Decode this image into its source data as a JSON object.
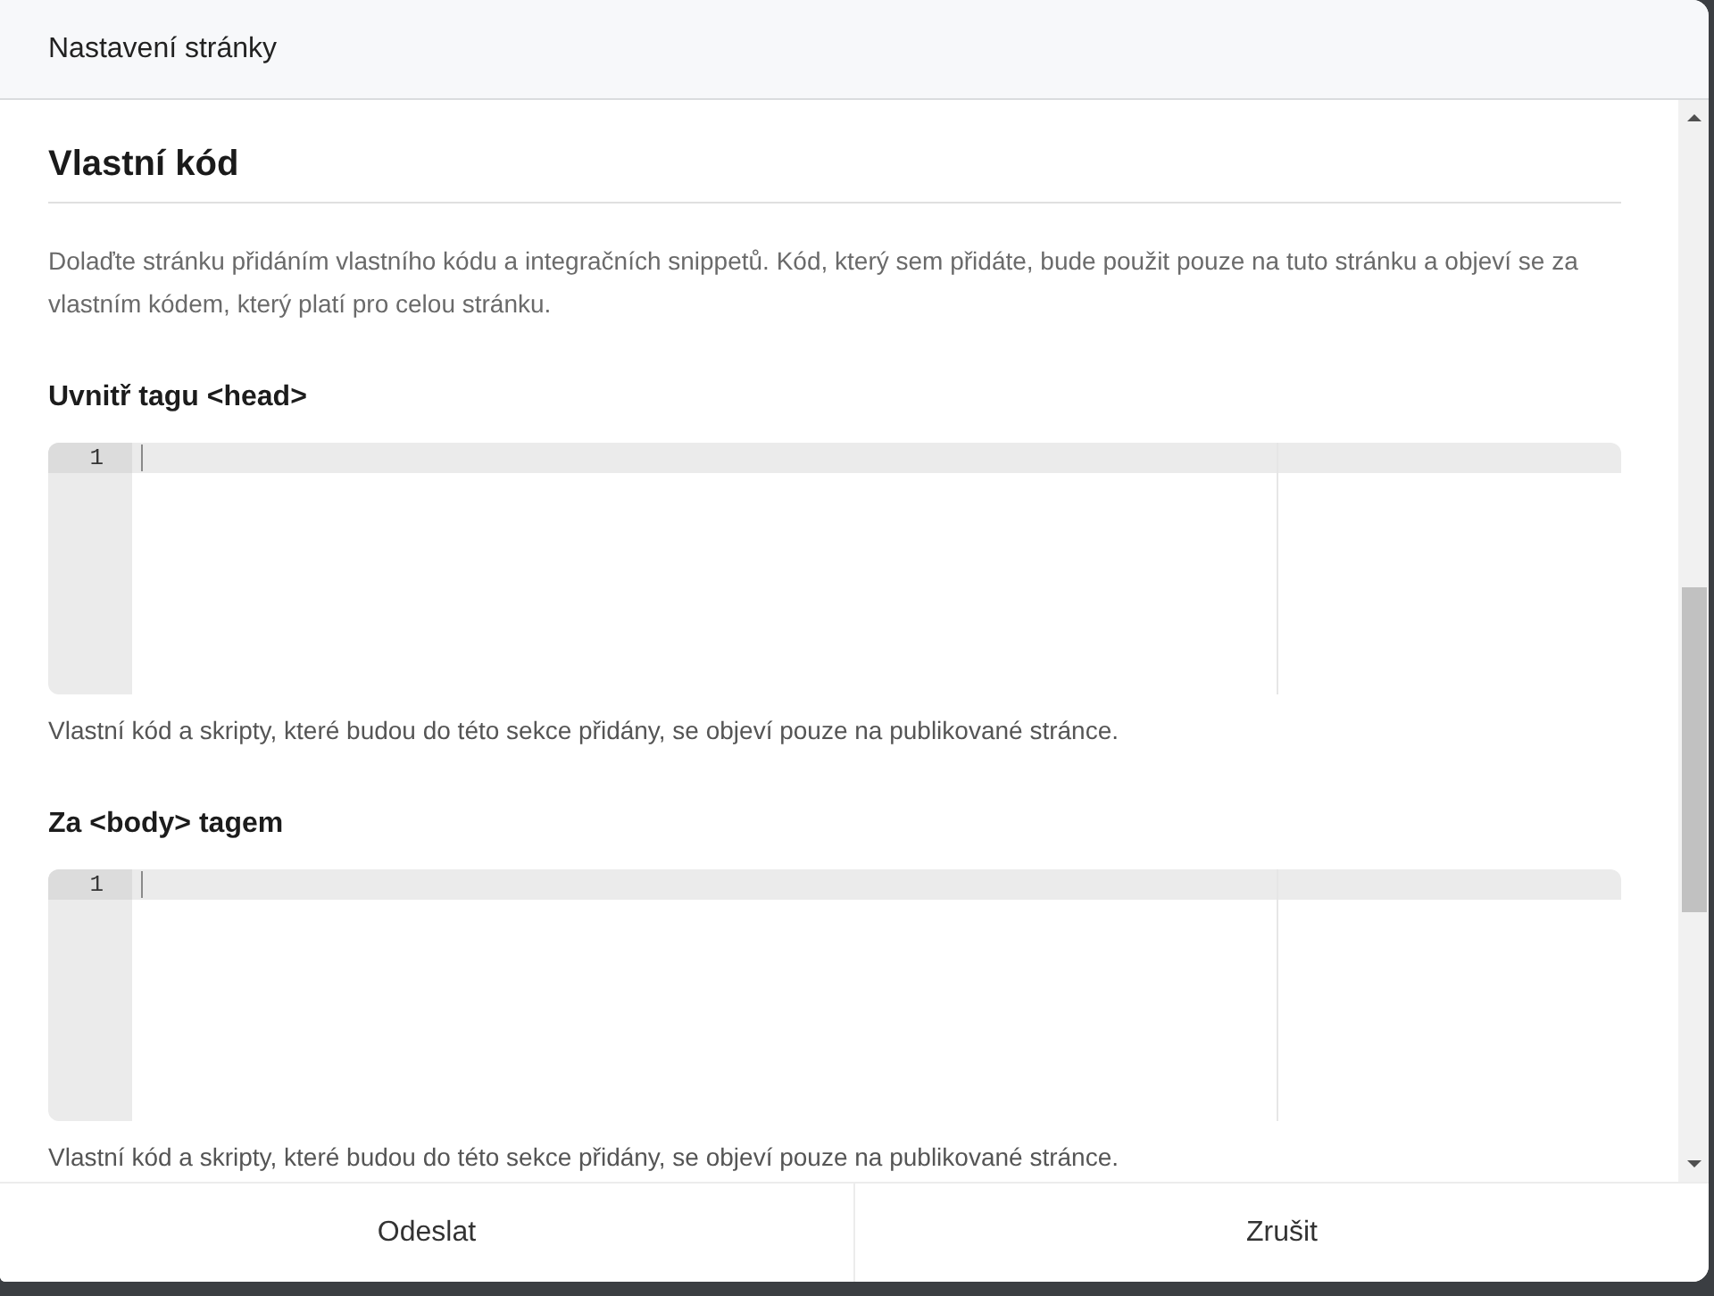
{
  "dialog": {
    "title": "Nastavení stránky"
  },
  "section": {
    "title": "Vlastní kód",
    "description": "Dolaďte stránku přidáním vlastního kódu a integračních snippetů. Kód, který sem přidáte, bude použit pouze na tuto stránku a objeví se za vlastním kódem, který platí pro celou stránku."
  },
  "code_fields": [
    {
      "label": "Uvnitř tagu <head>",
      "lines": [
        {
          "number": "1",
          "active": true
        }
      ],
      "help": "Vlastní kód a skripty, které budou do této sekce přidány, se objeví pouze na publikované stránce."
    },
    {
      "label": "Za <body> tagem",
      "lines": [
        {
          "number": "1",
          "active": true
        }
      ],
      "help": "Vlastní kód a skripty, které budou do této sekce přidány, se objeví pouze na publikované stránce."
    }
  ],
  "buttons": [
    {
      "label": "Odeslat"
    },
    {
      "label": "Zrušit"
    }
  ]
}
